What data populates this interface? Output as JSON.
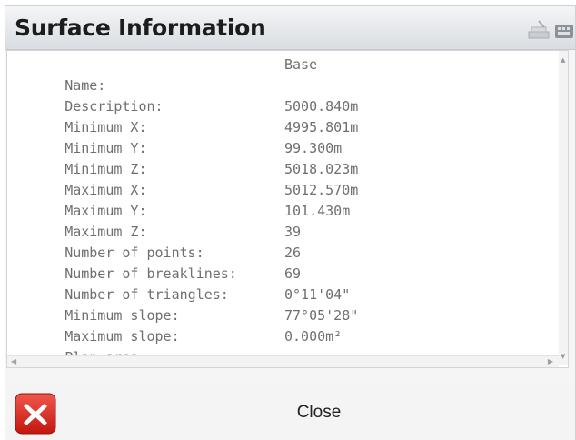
{
  "window": {
    "title": "Surface Information",
    "close_label": "Close"
  },
  "icons": {
    "title_icon_1": "stack-icon",
    "title_icon_2": "keyboard-icon",
    "close_icon": "close-x-icon"
  },
  "colors": {
    "close_red": "#d9261c",
    "text_gray": "#6f6f6f"
  },
  "rows": [
    {
      "label": "Name:",
      "value": "Base"
    },
    {
      "label": "Description:",
      "value": ""
    },
    {
      "label": "Minimum X:",
      "value": "5000.840m"
    },
    {
      "label": "Minimum Y:",
      "value": "4995.801m"
    },
    {
      "label": "Minimum Z:",
      "value": "99.300m"
    },
    {
      "label": "Maximum X:",
      "value": "5018.023m"
    },
    {
      "label": "Maximum Y:",
      "value": "5012.570m"
    },
    {
      "label": "Maximum Z:",
      "value": "101.430m"
    },
    {
      "label": "Number of points:",
      "value": "39"
    },
    {
      "label": "Number of breaklines:",
      "value": "26"
    },
    {
      "label": "Number of triangles:",
      "value": "69"
    },
    {
      "label": "Minimum slope:",
      "value": "0°11'04\""
    },
    {
      "label": "Maximum slope:",
      "value": "77°05'28\""
    },
    {
      "label": "Plan area:",
      "value": "0.000m²"
    }
  ]
}
